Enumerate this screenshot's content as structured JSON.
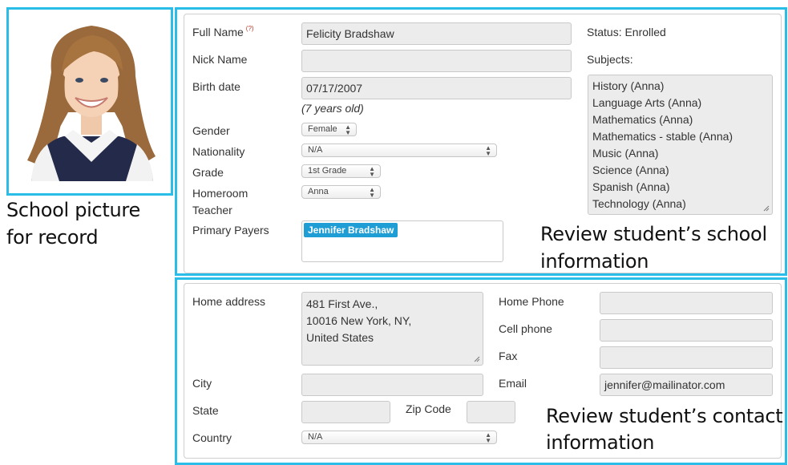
{
  "photo": {
    "alt": "School picture"
  },
  "captions": {
    "photo_line1": "School picture",
    "photo_line2": "for record",
    "school_line1": "Review student’s school",
    "school_line2": "information",
    "contact_line1": "Review student’s contact",
    "contact_line2": "information"
  },
  "school": {
    "full_name_label": "Full Name",
    "required_mark": "(?)",
    "full_name_value": "Felicity Bradshaw",
    "nick_name_label": "Nick Name",
    "nick_name_value": "",
    "birth_date_label": "Birth date",
    "birth_date_value": "07/17/2007",
    "age_note": "(7 years old)",
    "gender_label": "Gender",
    "gender_value": "Female",
    "nationality_label": "Nationality",
    "nationality_value": "N/A",
    "grade_label": "Grade",
    "grade_value": "1st Grade",
    "homeroom_label_1": "Homeroom",
    "homeroom_label_2": "Teacher",
    "homeroom_value": "Anna",
    "payers_label": "Primary Payers",
    "payers": [
      "Jennifer Bradshaw"
    ],
    "status_text": "Status: Enrolled",
    "subjects_label": "Subjects:",
    "subjects": [
      "History (Anna)",
      "Language Arts (Anna)",
      "Mathematics (Anna)",
      "Mathematics - stable (Anna)",
      "Music (Anna)",
      "Science (Anna)",
      "Spanish (Anna)",
      "Technology (Anna)"
    ]
  },
  "contact": {
    "home_address_label": "Home address",
    "address_lines": [
      "481 First Ave.,",
      "10016 New York, NY,",
      "United States"
    ],
    "city_label": "City",
    "city_value": "",
    "state_label": "State",
    "state_value": "",
    "zip_label": "Zip Code",
    "zip_value": "",
    "country_label": "Country",
    "country_value": "N/A",
    "home_phone_label": "Home Phone",
    "home_phone_value": "",
    "cell_phone_label": "Cell phone",
    "cell_phone_value": "",
    "fax_label": "Fax",
    "fax_value": "",
    "email_label": "Email",
    "email_value": "jennifer@mailinator.com"
  },
  "colors": {
    "highlight": "#29bde8",
    "tag": "#1f9ed5",
    "field_bg": "#ececec",
    "required": "#c0392b"
  }
}
